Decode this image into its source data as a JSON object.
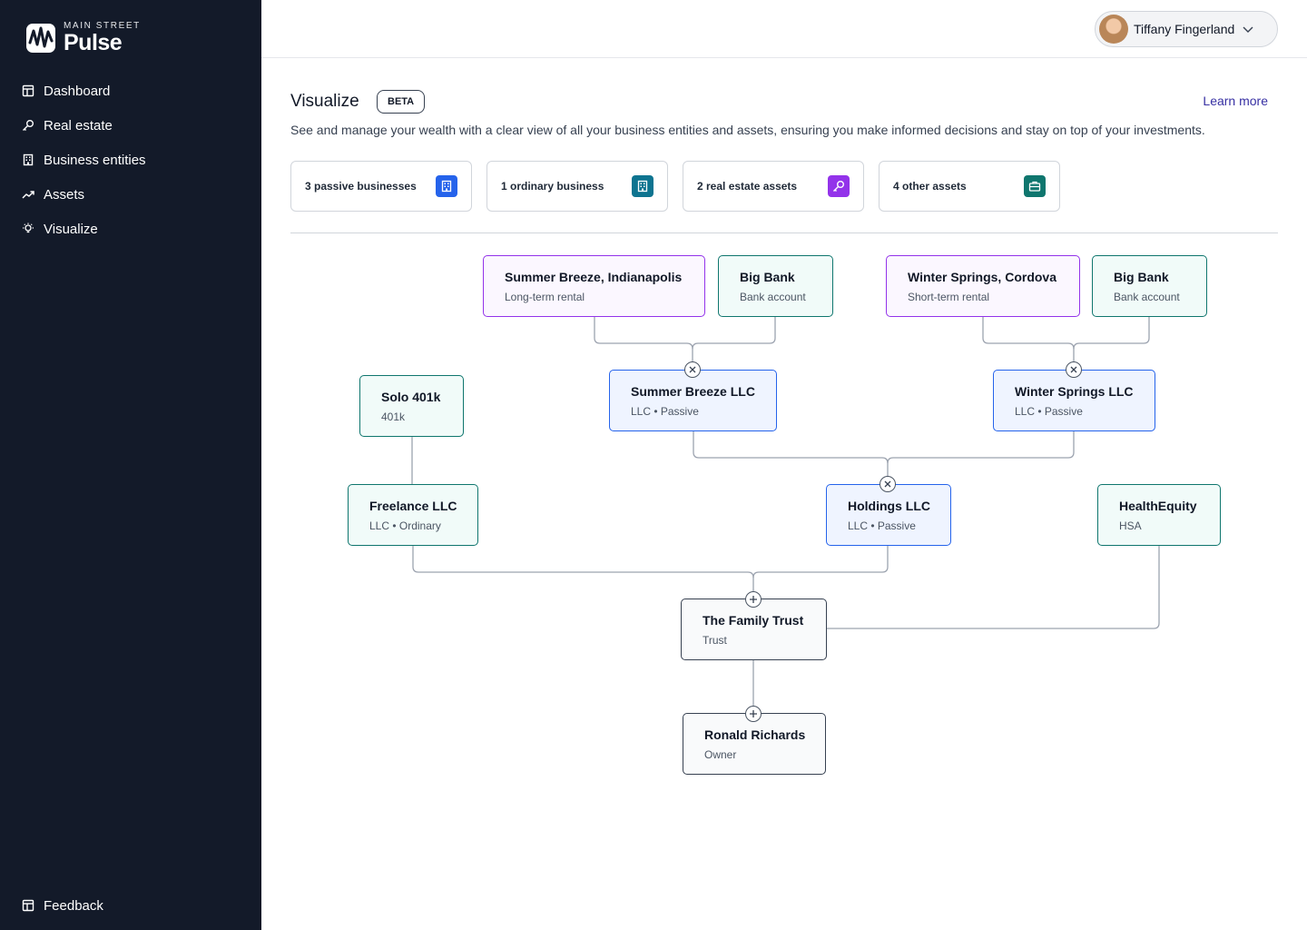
{
  "brand": {
    "top": "MAIN STREET",
    "name": "Pulse"
  },
  "sidebar": {
    "items": [
      {
        "label": "Dashboard",
        "icon": "dashboard-icon"
      },
      {
        "label": "Real estate",
        "icon": "key-icon"
      },
      {
        "label": "Business entities",
        "icon": "building-icon"
      },
      {
        "label": "Assets",
        "icon": "trending-up-icon"
      },
      {
        "label": "Visualize",
        "icon": "lightbulb-icon"
      }
    ],
    "feedback": {
      "label": "Feedback",
      "icon": "feedback-icon"
    }
  },
  "header": {
    "user_name": "Tiffany Fingerland"
  },
  "page": {
    "title": "Visualize",
    "badge": "BETA",
    "learn_more": "Learn more",
    "description": "See and manage your wealth with a clear view of all your business entities and assets, ensuring you make informed decisions and stay on top of your investments."
  },
  "stats": [
    {
      "label": "3 passive businesses",
      "icon": "building-icon",
      "color": "#2563eb"
    },
    {
      "label": "1 ordinary business",
      "icon": "building-icon",
      "color": "#0e7490"
    },
    {
      "label": "2 real estate assets",
      "icon": "key-icon",
      "color": "#9333ea"
    },
    {
      "label": "4 other assets",
      "icon": "briefcase-icon",
      "color": "#0f766e"
    }
  ],
  "diagram": {
    "summer_breeze_property": {
      "title": "Summer Breeze, Indianapolis",
      "subtitle": "Long-term rental"
    },
    "big_bank_1": {
      "title": "Big Bank",
      "subtitle": "Bank account"
    },
    "winter_springs_property": {
      "title": "Winter Springs, Cordova",
      "subtitle": "Short-term rental"
    },
    "big_bank_2": {
      "title": "Big Bank",
      "subtitle": "Bank account"
    },
    "summer_breeze_llc": {
      "title": "Summer Breeze LLC",
      "subtitle": "LLC • Passive"
    },
    "winter_springs_llc": {
      "title": "Winter Springs LLC",
      "subtitle": "LLC • Passive"
    },
    "solo_401k": {
      "title": "Solo 401k",
      "subtitle": "401k"
    },
    "freelance_llc": {
      "title": "Freelance LLC",
      "subtitle": "LLC • Ordinary"
    },
    "holdings_llc": {
      "title": "Holdings LLC",
      "subtitle": "LLC • Passive"
    },
    "health_equity": {
      "title": "HealthEquity",
      "subtitle": "HSA"
    },
    "family_trust": {
      "title": "The Family Trust",
      "subtitle": "Trust"
    },
    "owner": {
      "title": "Ronald Richards",
      "subtitle": "Owner"
    }
  }
}
